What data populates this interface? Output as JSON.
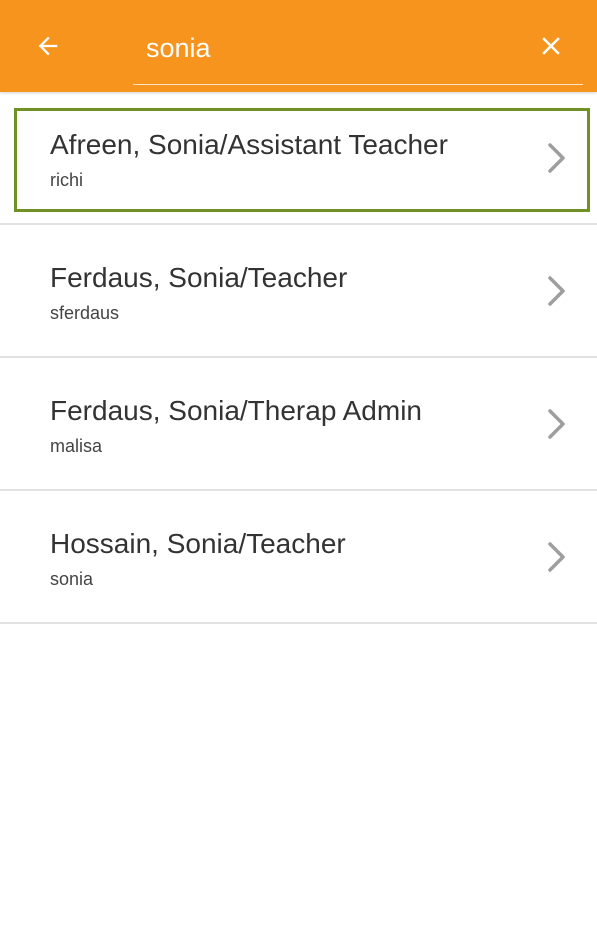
{
  "header": {
    "search": {
      "value": "sonia"
    },
    "icons": {
      "back": "arrow-left-icon",
      "clear": "close-icon"
    },
    "colors": {
      "background": "#f7941d",
      "foreground": "#ffffff"
    }
  },
  "results": [
    {
      "title": "Afreen, Sonia/Assistant Teacher",
      "subtitle": "richi",
      "focused": true
    },
    {
      "title": "Ferdaus, Sonia/Teacher",
      "subtitle": "sferdaus",
      "focused": false
    },
    {
      "title": "Ferdaus, Sonia/Therap Admin",
      "subtitle": "malisa",
      "focused": false
    },
    {
      "title": "Hossain, Sonia/Teacher",
      "subtitle": "sonia",
      "focused": false
    }
  ],
  "colors": {
    "focus_outline": "#6f9125",
    "divider": "#e2e2e2",
    "chevron": "#9e9e9e"
  }
}
